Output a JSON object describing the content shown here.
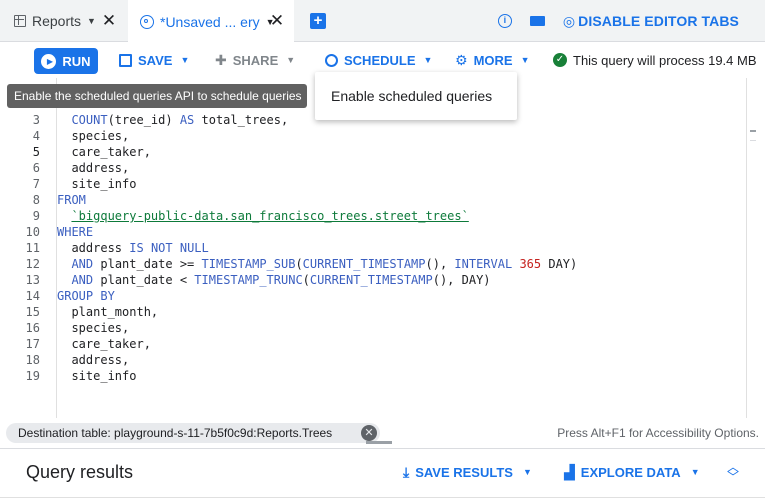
{
  "tabs": [
    {
      "label": "Reports"
    },
    {
      "label": "*Unsaved ... ery"
    }
  ],
  "header": {
    "disable_editor_tabs": "DISABLE EDITOR TABS"
  },
  "toolbar": {
    "run_label": "RUN",
    "save_label": "SAVE",
    "share_label": "SHARE",
    "schedule_label": "SCHEDULE",
    "more_label": "MORE",
    "status_text": "This query will process 19.4 MB"
  },
  "tooltip": {
    "text": "Enable the scheduled queries API to schedule queries"
  },
  "schedule_menu": {
    "items": [
      "Enable scheduled queries"
    ]
  },
  "editor": {
    "lines": [
      {
        "n": "3",
        "text": "  COUNT(tree_id) AS total_trees,"
      },
      {
        "n": "4",
        "text": "  species,"
      },
      {
        "n": "5",
        "text": "  care_taker,"
      },
      {
        "n": "6",
        "text": "  address,"
      },
      {
        "n": "7",
        "text": "  site_info"
      },
      {
        "n": "8",
        "text": "FROM"
      },
      {
        "n": "9",
        "text": "  `bigquery-public-data.san_francisco_trees.street_trees`"
      },
      {
        "n": "10",
        "text": "WHERE"
      },
      {
        "n": "11",
        "text": "  address IS NOT NULL"
      },
      {
        "n": "12",
        "text": "  AND plant_date >= TIMESTAMP_SUB(CURRENT_TIMESTAMP(), INTERVAL 365 DAY)"
      },
      {
        "n": "13",
        "text": "  AND plant_date < TIMESTAMP_TRUNC(CURRENT_TIMESTAMP(), DAY)"
      },
      {
        "n": "14",
        "text": "GROUP BY"
      },
      {
        "n": "15",
        "text": "  plant_month,"
      },
      {
        "n": "16",
        "text": "  species,"
      },
      {
        "n": "17",
        "text": "  care_taker,"
      },
      {
        "n": "18",
        "text": "  address,"
      },
      {
        "n": "19",
        "text": "  site_info"
      }
    ]
  },
  "destination": {
    "chip_text": "Destination table: playground-s-11-7b5f0c9d:Reports.Trees",
    "accessibility_hint": "Press Alt+F1 for Accessibility Options."
  },
  "results": {
    "title": "Query results",
    "save_results_label": "SAVE RESULTS",
    "explore_data_label": "EXPLORE DATA"
  },
  "colors": {
    "accent": "#1a73e8",
    "keyword": "#3b5fc0",
    "number": "#c5221f",
    "string": "#0d7a3a",
    "success": "#188038"
  },
  "icons": {
    "reports_tab": "table-icon",
    "unsaved_tab": "query-search-icon",
    "add_tab": "plus-square-icon",
    "help": "help-circle-icon",
    "keyboard": "keyboard-icon",
    "disable_tabs": "eye-off-icon",
    "run": "play-circle-icon",
    "save": "floppy-icon",
    "share": "person-add-icon",
    "schedule": "clock-icon",
    "more": "gear-icon",
    "status": "check-circle-icon",
    "save_results": "download-icon",
    "explore_data": "bar-chart-icon",
    "expand": "unfold-icon"
  }
}
